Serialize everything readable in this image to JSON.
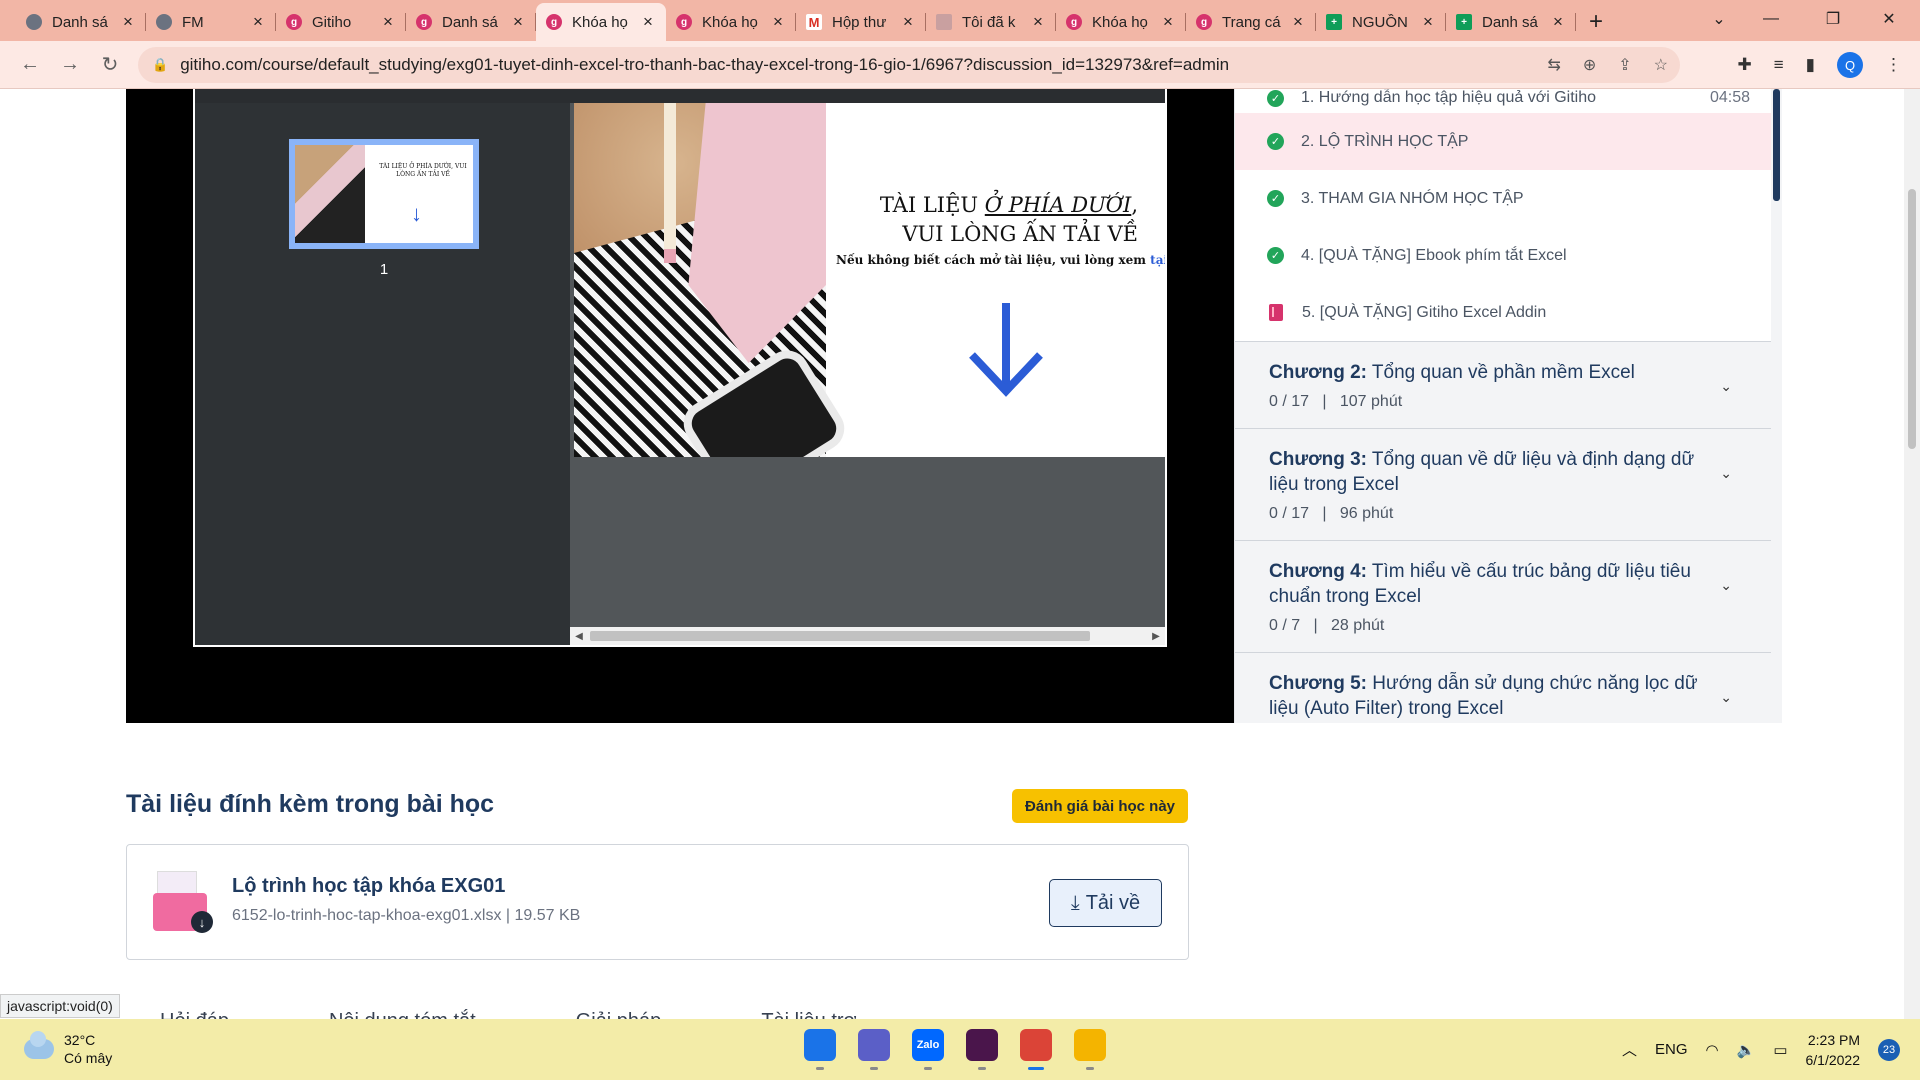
{
  "browser": {
    "tabs": [
      {
        "label": "Danh sá",
        "favicon": "globe"
      },
      {
        "label": "FM",
        "favicon": "globe"
      },
      {
        "label": "Gitiho",
        "favicon": "gitiho"
      },
      {
        "label": "Danh sá",
        "favicon": "gitiho"
      },
      {
        "label": "Khóa họ",
        "favicon": "gitiho",
        "active": true
      },
      {
        "label": "Khóa họ",
        "favicon": "gitiho"
      },
      {
        "label": "Hộp thư",
        "favicon": "gmail"
      },
      {
        "label": "Tôi đã k",
        "favicon": "img"
      },
      {
        "label": "Khóa họ",
        "favicon": "gitiho"
      },
      {
        "label": "Trang cá",
        "favicon": "gitiho"
      },
      {
        "label": "NGUỒN",
        "favicon": "sheets"
      },
      {
        "label": "Danh sá",
        "favicon": "sheets"
      }
    ],
    "new_tab": "+",
    "url": "gitiho.com/course/default_studying/exg01-tuyet-dinh-excel-tro-thanh-bac-thay-excel-trong-16-gio-1/6967?discussion_id=132973&ref=admin",
    "profile_initial": "Q"
  },
  "viewer": {
    "thumb_number": "1",
    "thumb_title": "TÀI LIỆU Ở PHÍA DƯỚI, VUI LÒNG ẤN TẢI VỀ",
    "title_line1_pre": "TÀI LIỆU ",
    "title_line1_emph": "Ở PHÍA DƯỚI",
    "title_line1_post": ",",
    "title_line2": "VUI LÒNG ẤN TẢI VỀ",
    "subtitle": "Nếu không biết cách mở tài liệu, vui lòng xem ",
    "subtitle_link": "tại"
  },
  "syllabus": {
    "lessons": [
      {
        "label": "1. Hướng dẫn học tập hiệu quả với Gitiho",
        "duration": "04:58",
        "status": "done"
      },
      {
        "label": "2. LỘ TRÌNH HỌC TẬP",
        "status": "done",
        "active": true
      },
      {
        "label": "3. THAM GIA NHÓM HỌC TẬP",
        "status": "done"
      },
      {
        "label": "4. [QUÀ TẶNG] Ebook phím tắt Excel",
        "status": "done"
      },
      {
        "label": "5. [QUÀ TẶNG] Gitiho Excel Addin",
        "status": "document"
      }
    ],
    "chapters": [
      {
        "prefix": "Chương 2:",
        "title": " Tổng quan về phần mềm Excel",
        "progress": "0 / 17",
        "duration": "107 phút"
      },
      {
        "prefix": "Chương 3:",
        "title": " Tổng quan về dữ liệu và định dạng dữ liệu trong Excel",
        "progress": "0 / 17",
        "duration": "96 phút"
      },
      {
        "prefix": "Chương 4:",
        "title": " Tìm hiểu về cấu trúc bảng dữ liệu tiêu chuẩn trong Excel",
        "progress": "0 / 7",
        "duration": "28 phút"
      },
      {
        "prefix": "Chương 5:",
        "title": " Hướng dẫn sử dụng chức năng lọc dữ liệu (Auto Filter) trong Excel",
        "progress": "",
        "duration": ""
      }
    ],
    "separator": "|"
  },
  "attachments": {
    "heading": "Tài liệu đính kèm trong bài học",
    "rate_button": "Đánh giá bài học này",
    "file_name": "Lộ trình học tập khóa EXG01",
    "file_meta": "6152-lo-trinh-hoc-tap-khoa-exg01.xlsx   |   19.57 KB",
    "download_label": "Tải về"
  },
  "page_tabs_peek": [
    "Hỏi đáp",
    "Nội dung tóm tắt",
    "Giải pháp",
    "Tài liệu trợ"
  ],
  "status_link": "javascript:void(0)",
  "taskbar": {
    "temperature": "32°C",
    "weather": "Có mây",
    "language": "ENG",
    "time": "2:23 PM",
    "date": "6/1/2022",
    "notifications": "23",
    "apps": [
      {
        "name": "windows-start",
        "color": "#1a73e8"
      },
      {
        "name": "teams",
        "color": "#5b5fc7"
      },
      {
        "name": "zalo",
        "color": "#0068ff",
        "label": "Zalo"
      },
      {
        "name": "slack",
        "color": "#4a154b"
      },
      {
        "name": "chrome",
        "color": "#db4437",
        "active": true
      },
      {
        "name": "file-explorer",
        "color": "#f4b400"
      }
    ]
  }
}
